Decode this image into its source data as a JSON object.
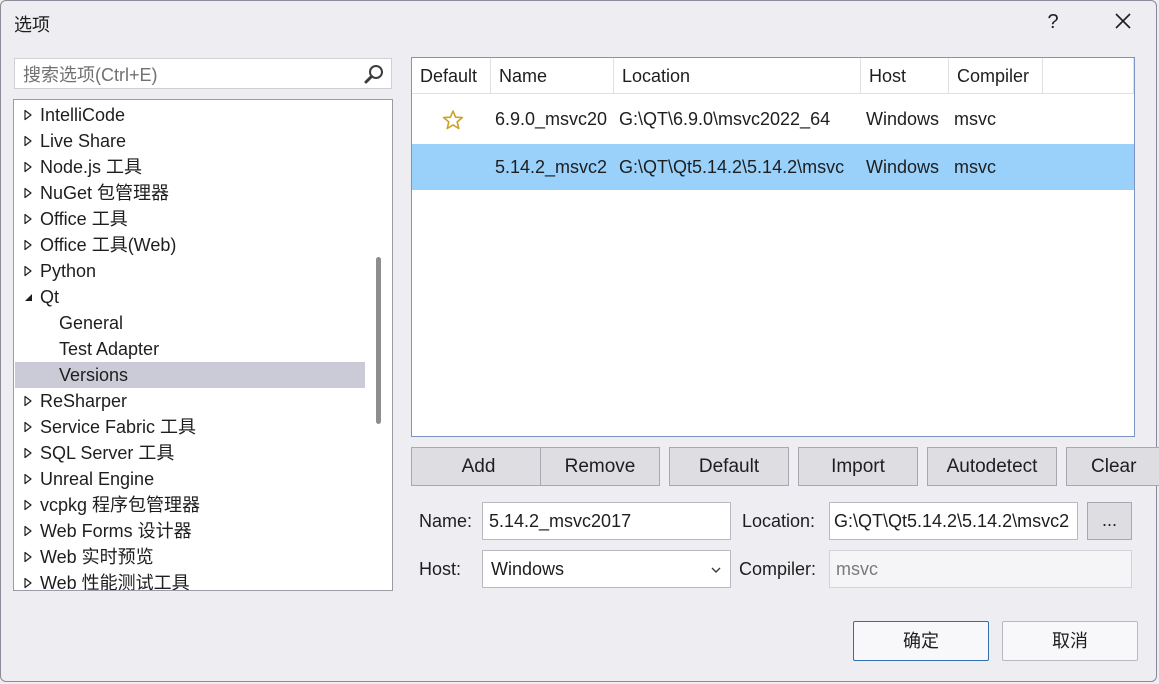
{
  "window": {
    "title": "选项",
    "help_label": "?",
    "close_icon": "close-icon"
  },
  "search": {
    "placeholder": "搜索选项(Ctrl+E)",
    "icon": "search-icon"
  },
  "tree": {
    "items": [
      {
        "label": "IntelliCode",
        "state": "collapsed"
      },
      {
        "label": "Live Share",
        "state": "collapsed"
      },
      {
        "label": "Node.js 工具",
        "state": "collapsed"
      },
      {
        "label": "NuGet 包管理器",
        "state": "collapsed"
      },
      {
        "label": "Office 工具",
        "state": "collapsed"
      },
      {
        "label": "Office 工具(Web)",
        "state": "collapsed"
      },
      {
        "label": "Python",
        "state": "collapsed"
      },
      {
        "label": "Qt",
        "state": "expanded"
      },
      {
        "label": "General",
        "state": "child"
      },
      {
        "label": "Test Adapter",
        "state": "child"
      },
      {
        "label": "Versions",
        "state": "child-selected"
      },
      {
        "label": "ReSharper",
        "state": "collapsed"
      },
      {
        "label": "Service Fabric 工具",
        "state": "collapsed"
      },
      {
        "label": "SQL Server 工具",
        "state": "collapsed"
      },
      {
        "label": "Unreal Engine",
        "state": "collapsed"
      },
      {
        "label": "vcpkg 程序包管理器",
        "state": "collapsed"
      },
      {
        "label": "Web Forms 设计器",
        "state": "collapsed"
      },
      {
        "label": "Web 实时预览",
        "state": "collapsed"
      },
      {
        "label": "Web 性能测试工具",
        "state": "collapsed"
      }
    ]
  },
  "versions": {
    "columns": [
      "Default",
      "Name",
      "Location",
      "Host",
      "Compiler"
    ],
    "rows": [
      {
        "default": true,
        "name": "6.9.0_msvc20",
        "location": "G:\\QT\\6.9.0\\msvc2022_64",
        "host": "Windows",
        "compiler": "msvc",
        "selected": false
      },
      {
        "default": false,
        "name": "5.14.2_msvc2",
        "location": "G:\\QT\\Qt5.14.2\\5.14.2\\msvc",
        "host": "Windows",
        "compiler": "msvc",
        "selected": true
      }
    ]
  },
  "actions": {
    "add": "Add",
    "remove": "Remove",
    "default": "Default",
    "import": "Import",
    "autodetect": "Autodetect",
    "clear": "Clear"
  },
  "form": {
    "name_label": "Name:",
    "name_value": "5.14.2_msvc2017",
    "location_label": "Location:",
    "location_value": "G:\\QT\\Qt5.14.2\\5.14.2\\msvc2",
    "browse_label": "...",
    "host_label": "Host:",
    "host_value": "Windows",
    "compiler_label": "Compiler:",
    "compiler_value": "msvc"
  },
  "footer": {
    "ok": "确定",
    "cancel": "取消"
  },
  "colors": {
    "selection": "#99d1fb",
    "tree_selection": "#cbcbd8",
    "accent_border": "#2f6fb0",
    "star": "#c9a227"
  }
}
